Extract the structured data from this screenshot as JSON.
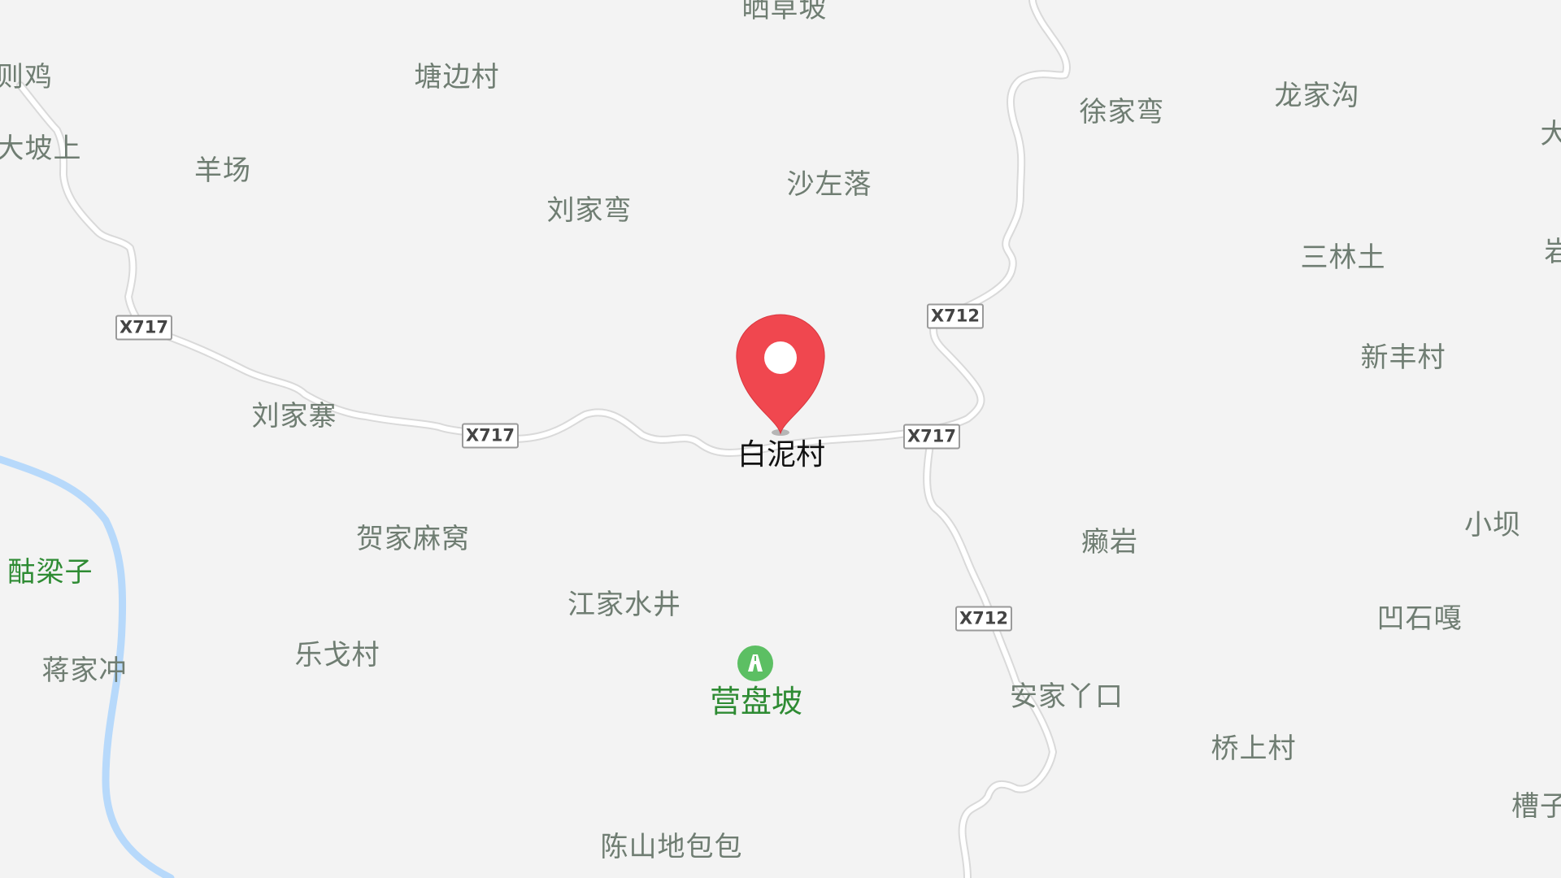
{
  "map": {
    "places": [
      {
        "id": "place-shaicaopo",
        "label": "晒草坡"
      },
      {
        "id": "place-zeji",
        "label": "则鸡"
      },
      {
        "id": "place-tangbiancun",
        "label": "塘边村"
      },
      {
        "id": "place-xujiawan",
        "label": "徐家弯"
      },
      {
        "id": "place-longjiagou",
        "label": "龙家沟"
      },
      {
        "id": "place-dapoushang",
        "label": "大坡上"
      },
      {
        "id": "place-yangchang",
        "label": "羊场"
      },
      {
        "id": "place-shazuoluo",
        "label": "沙左落"
      },
      {
        "id": "place-liujiawan",
        "label": "刘家弯"
      },
      {
        "id": "place-sanlintu",
        "label": "三林土"
      },
      {
        "id": "place-xinfengcun",
        "label": "新丰村"
      },
      {
        "id": "place-liujiazhai",
        "label": "刘家寨"
      },
      {
        "id": "place-hejiamawo",
        "label": "贺家麻窝"
      },
      {
        "id": "place-laiyan",
        "label": "癞岩"
      },
      {
        "id": "place-xiaoba",
        "label": "小坝"
      },
      {
        "id": "place-jiangjiashuijing",
        "label": "江家水井"
      },
      {
        "id": "place-aoshiga",
        "label": "凹石嘎"
      },
      {
        "id": "place-jiangjiachong",
        "label": "蒋家冲"
      },
      {
        "id": "place-legecun",
        "label": "乐戈村"
      },
      {
        "id": "place-anjiayakou",
        "label": "安家丫口"
      },
      {
        "id": "place-qiaoshangcun",
        "label": "桥上村"
      },
      {
        "id": "place-chenshandibaobao",
        "label": "陈山地包包"
      },
      {
        "id": "place-cao",
        "label": "槽子"
      },
      {
        "id": "place-da-right",
        "label": "大"
      },
      {
        "id": "place-yan-right",
        "label": "岩"
      }
    ],
    "green_places": [
      {
        "id": "place-liangzi",
        "label": "酤梁子"
      }
    ],
    "road_shields": [
      {
        "id": "shield-x717-1",
        "label": "X717"
      },
      {
        "id": "shield-x717-2",
        "label": "X717"
      },
      {
        "id": "shield-x717-3",
        "label": "X717"
      },
      {
        "id": "shield-x712-1",
        "label": "X712"
      },
      {
        "id": "shield-x712-2",
        "label": "X712"
      }
    ],
    "marker": {
      "label": "白泥村",
      "color": "#f0474f"
    },
    "poi": {
      "label": "营盘坡",
      "icon": "mountain-pass-icon",
      "color": "#5cbf63"
    },
    "colors": {
      "background": "#f3f3f3",
      "road": "#ffffff",
      "road_casing": "#d9d9d9",
      "river": "#b7d9fb",
      "label": "#6f7d72",
      "green_label": "#2e8b33"
    }
  }
}
